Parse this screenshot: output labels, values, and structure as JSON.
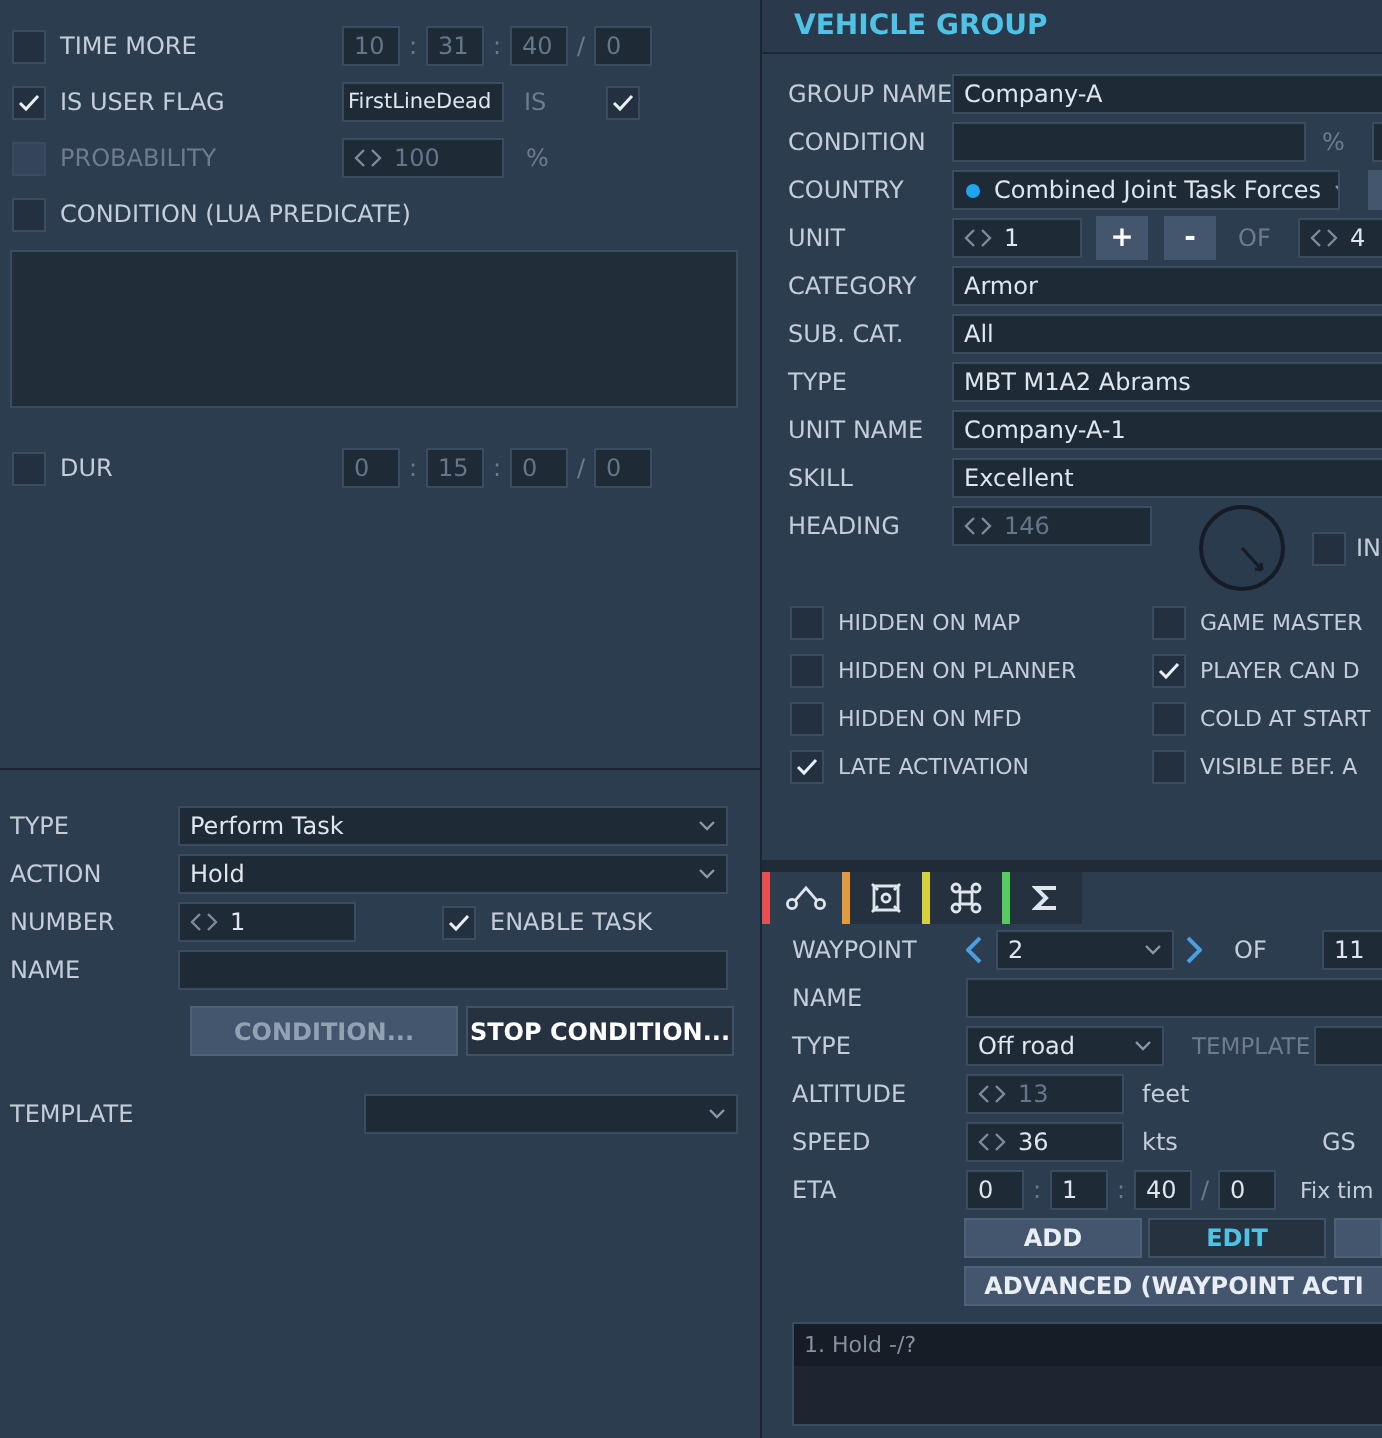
{
  "left": {
    "conditions": [
      {
        "kind": "time",
        "label": "TIME MORE",
        "checked": false,
        "disabled": false,
        "time": {
          "disabled": true,
          "parts": [
            "10",
            "31",
            "40",
            "0"
          ],
          "separators": [
            ":",
            ":",
            "/"
          ]
        }
      },
      {
        "kind": "flag",
        "label": "IS USER FLAG",
        "checked": true,
        "disabled": false,
        "flag": "FirstLineDead",
        "is_label": "IS",
        "is_checked": true
      },
      {
        "kind": "percent",
        "label": "PROBABILITY",
        "checked": false,
        "disabled": true,
        "value": "100",
        "unit": "%"
      },
      {
        "kind": "lua",
        "label": "CONDITION (LUA PREDICATE)",
        "checked": false,
        "disabled": false
      },
      {
        "kind": "time",
        "label": "DUR",
        "checked": false,
        "disabled": false,
        "time": {
          "disabled": true,
          "parts": [
            "0",
            "15",
            "0",
            "0"
          ],
          "separators": [
            ":",
            ":",
            "/"
          ]
        }
      }
    ],
    "task": {
      "rows": [
        {
          "label": "TYPE",
          "kind": "dropdown",
          "value": "Perform Task"
        },
        {
          "label": "ACTION",
          "kind": "dropdown",
          "value": "Hold"
        },
        {
          "label": "NUMBER",
          "kind": "spin",
          "value": "1",
          "check": {
            "label": "ENABLE TASK",
            "checked": true
          }
        },
        {
          "label": "NAME",
          "kind": "text"
        }
      ],
      "buttons": [
        {
          "label": "CONDITION...",
          "kind": "filled",
          "disabled": true
        },
        {
          "label": "STOP CONDITION...",
          "kind": "outline",
          "disabled": false
        }
      ],
      "template": {
        "label": "TEMPLATE"
      }
    }
  },
  "vehicle_group": {
    "title": "VEHICLE GROUP",
    "rows": [
      {
        "label": "GROUP NAME",
        "kind": "text",
        "value": "Company-A"
      },
      {
        "label": "CONDITION",
        "kind": "percent",
        "unit": "%"
      },
      {
        "label": "COUNTRY",
        "kind": "country",
        "value": "Combined Joint Task Forces",
        "color": "#1ea7f0"
      },
      {
        "label": "UNIT",
        "kind": "unit",
        "value": "1",
        "plus": "+",
        "minus": "-",
        "of": "OF",
        "total": "4"
      },
      {
        "label": "CATEGORY",
        "kind": "select",
        "value": "Armor"
      },
      {
        "label": "SUB. CAT.",
        "kind": "select",
        "value": "All"
      },
      {
        "label": "TYPE",
        "kind": "select",
        "value": "MBT M1A2 Abrams"
      },
      {
        "label": "UNIT NAME",
        "kind": "text",
        "value": "Company-A-1"
      },
      {
        "label": "SKILL",
        "kind": "select",
        "value": "Excellent"
      },
      {
        "label": "HEADING",
        "kind": "heading",
        "value": "146",
        "disabled": true,
        "check": {
          "label": "IN",
          "checked": false
        }
      }
    ],
    "flags": [
      {
        "label": "HIDDEN ON MAP",
        "checked": false
      },
      {
        "label": "GAME MASTER",
        "checked": false
      },
      {
        "label": "HIDDEN ON PLANNER",
        "checked": false
      },
      {
        "label": "PLAYER CAN D",
        "checked": true
      },
      {
        "label": "HIDDEN ON MFD",
        "checked": false
      },
      {
        "label": "COLD AT START",
        "checked": false
      },
      {
        "label": "LATE ACTIVATION",
        "checked": true
      },
      {
        "label": "VISIBLE BEF. A",
        "checked": false
      }
    ]
  },
  "waypoints": {
    "tabs": [
      {
        "kind": "route",
        "color": "#e65050",
        "selected": true
      },
      {
        "kind": "target",
        "color": "#e29a3e",
        "selected": false
      },
      {
        "kind": "command",
        "color": "#d6d23c",
        "selected": false
      },
      {
        "kind": "sum",
        "color": "#55cc5e",
        "selected": false
      }
    ],
    "waypoint": {
      "label": "WAYPOINT",
      "value": "2",
      "of": "OF",
      "total": "11"
    },
    "rows": [
      {
        "label": "NAME",
        "kind": "text"
      },
      {
        "label": "TYPE",
        "kind": "type",
        "value": "Off road",
        "extra": "TEMPLATE"
      },
      {
        "label": "ALTITUDE",
        "kind": "spin",
        "value": "13",
        "disabled": true,
        "unit": "feet"
      },
      {
        "label": "SPEED",
        "kind": "spin",
        "value": "36",
        "disabled": false,
        "unit": "kts",
        "extra": "GS"
      },
      {
        "label": "ETA",
        "kind": "time",
        "parts": [
          "0",
          "1",
          "40",
          "0"
        ],
        "separators": [
          ":",
          ":",
          "/"
        ],
        "extra": "Fix tim"
      }
    ],
    "buttons": [
      {
        "label": "ADD",
        "kind": "filled",
        "selected": false
      },
      {
        "label": "EDIT",
        "kind": "outline",
        "selected": true
      },
      {
        "kind": "filled",
        "selected": false
      }
    ],
    "advanced": "ADVANCED (WAYPOINT ACTI",
    "actions": [
      {
        "text": "1. Hold -/?"
      }
    ]
  }
}
